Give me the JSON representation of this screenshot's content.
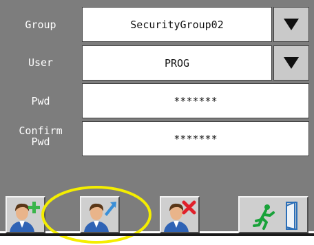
{
  "form": {
    "group_label": "Group",
    "group_value": "SecurityGroup02",
    "user_label": "User",
    "user_value": "PROG",
    "pwd_label": "Pwd",
    "pwd_value": "*******",
    "confirm_label_line1": "Confirm",
    "confirm_label_line2": "Pwd",
    "confirm_value": "*******"
  },
  "toolbar": {
    "buttons": [
      {
        "name": "add-user",
        "icon": "user-plus-icon"
      },
      {
        "name": "edit-user",
        "icon": "user-edit-icon",
        "highlighted": true
      },
      {
        "name": "delete-user",
        "icon": "user-delete-icon"
      },
      {
        "name": "exit",
        "icon": "exit-icon"
      }
    ]
  },
  "colors": {
    "panel": "#7d7d7d",
    "highlight_circle": "#f4ee00",
    "add_accent": "#3ab54a",
    "delete_accent": "#e0202a",
    "edit_accent": "#3a8fd8",
    "exit_figure": "#19a23a",
    "exit_door": "#2b6fb8"
  }
}
